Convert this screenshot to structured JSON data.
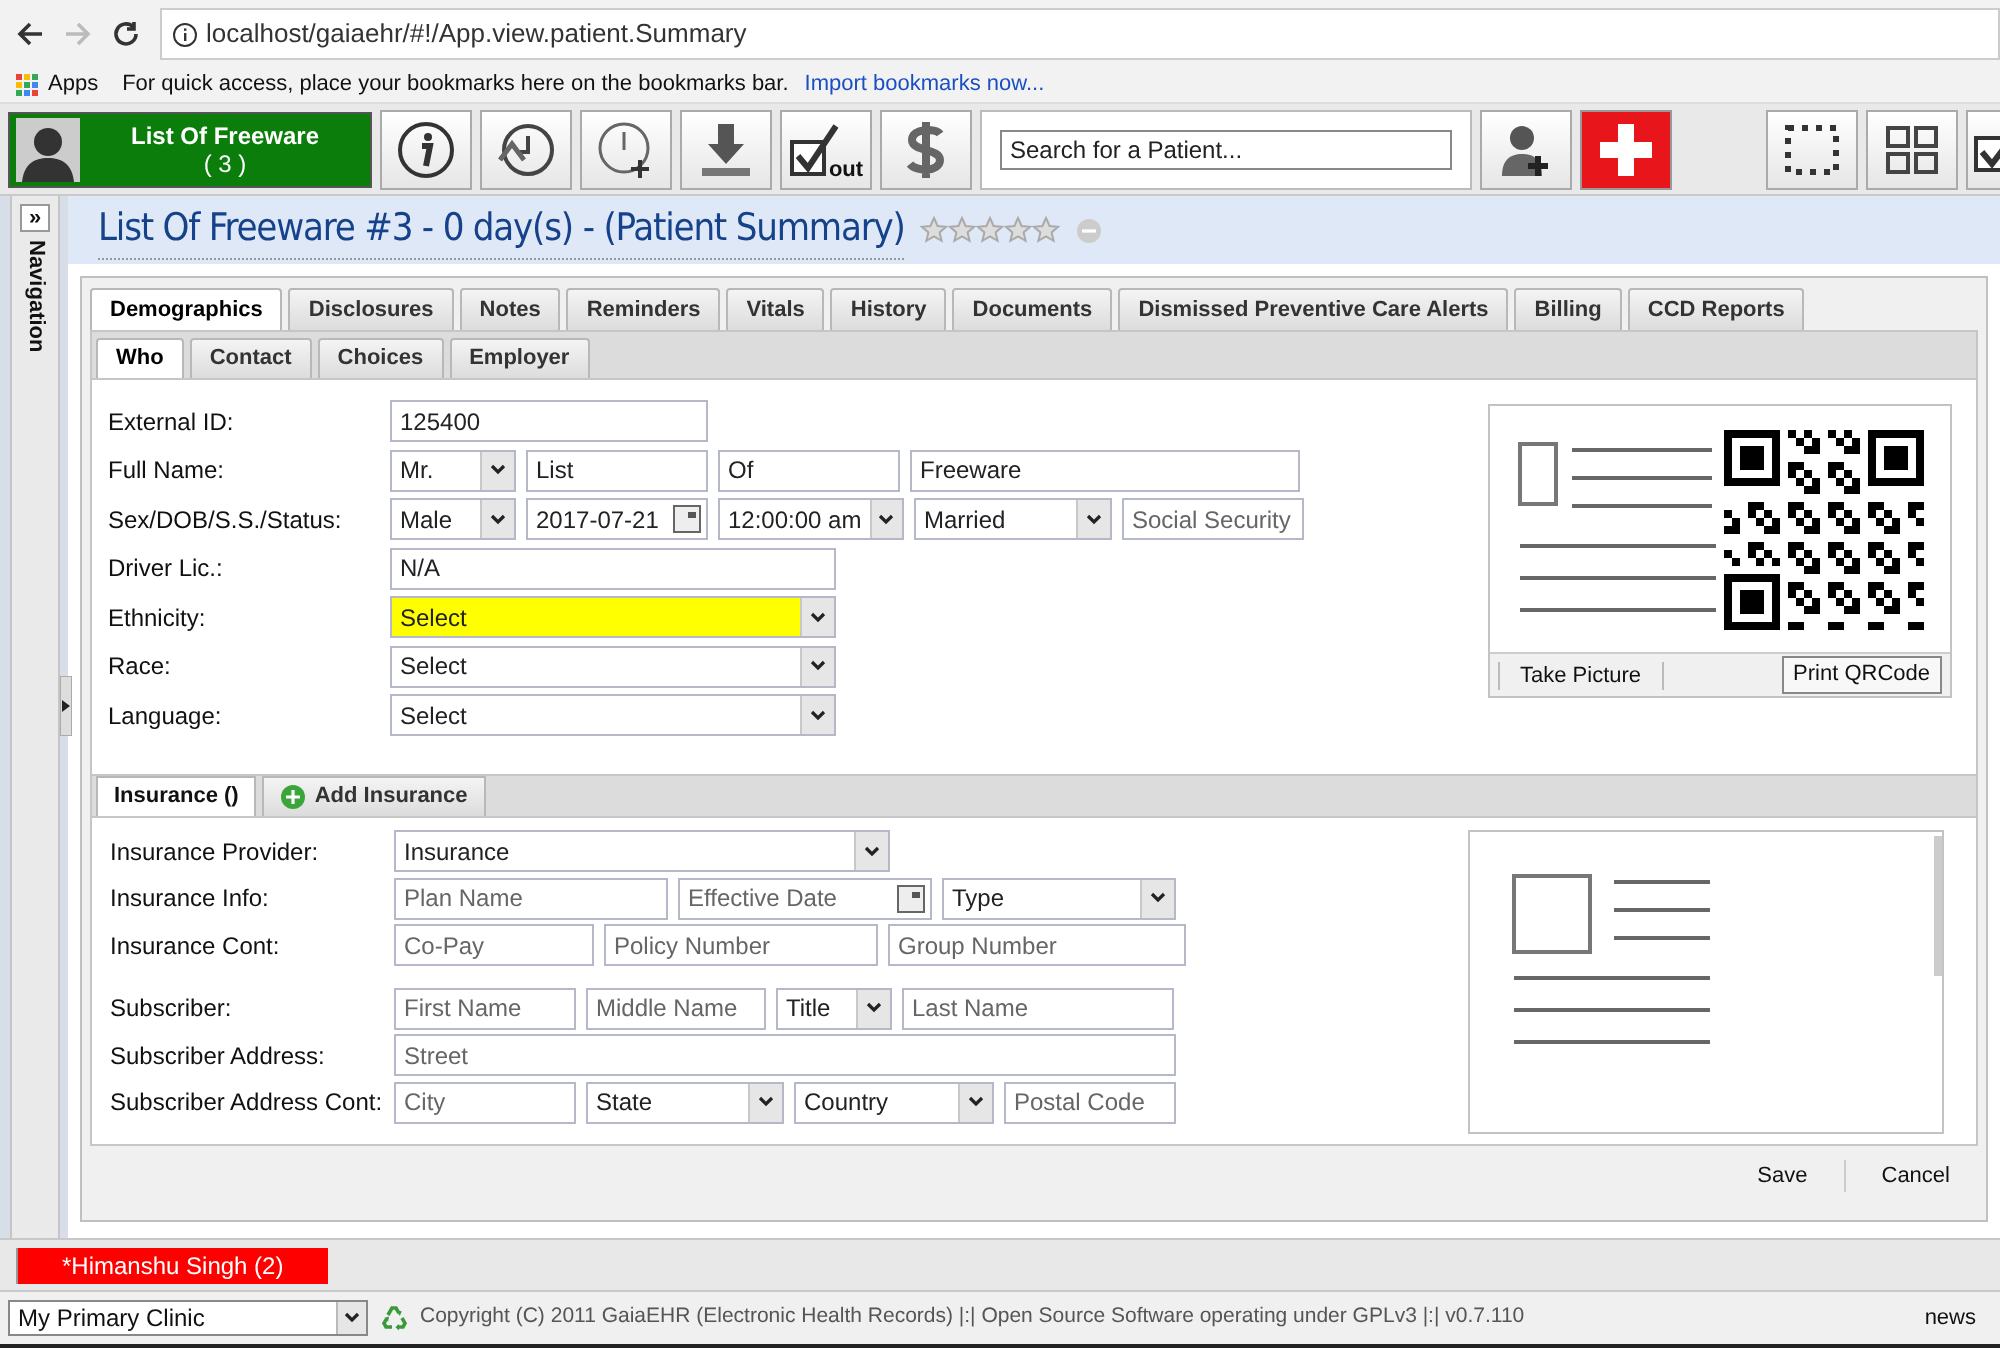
{
  "browser": {
    "url": "localhost/gaiaehr/#!/App.view.patient.Summary",
    "bookmarks": {
      "apps": "Apps",
      "message": "For quick access, place your bookmarks here on the bookmarks bar.",
      "link": "Import bookmarks now..."
    }
  },
  "toolbar": {
    "patient": {
      "name": "List Of Freeware",
      "count": "( 3 )"
    },
    "search": {
      "placeholder": "Search for a Patient..."
    },
    "checkout_label": "out"
  },
  "navigation": {
    "label": "Navigation",
    "toggle": "»"
  },
  "header": {
    "title": "List Of Freeware #3 - 0 day(s) - (Patient Summary)",
    "stars": 0
  },
  "tabs": [
    {
      "label": "Demographics",
      "selected": true
    },
    {
      "label": "Disclosures",
      "selected": false
    },
    {
      "label": "Notes",
      "selected": false
    },
    {
      "label": "Reminders",
      "selected": false
    },
    {
      "label": "Vitals",
      "selected": false
    },
    {
      "label": "History",
      "selected": false
    },
    {
      "label": "Documents",
      "selected": false
    },
    {
      "label": "Dismissed Preventive Care Alerts",
      "selected": false
    },
    {
      "label": "Billing",
      "selected": false
    },
    {
      "label": "CCD Reports",
      "selected": false
    }
  ],
  "subtabs": [
    {
      "label": "Who",
      "selected": true
    },
    {
      "label": "Contact",
      "selected": false
    },
    {
      "label": "Choices",
      "selected": false
    },
    {
      "label": "Employer",
      "selected": false
    }
  ],
  "demographics": [
    {
      "label": "External ID:",
      "highlighted": false,
      "fields": [
        {
          "kind": "text",
          "value": "125400"
        }
      ]
    },
    {
      "label": "Full Name:",
      "highlighted": false,
      "fields": [
        {
          "kind": "select",
          "value": "Mr."
        },
        {
          "kind": "text",
          "value": "List"
        },
        {
          "kind": "text",
          "value": "Of"
        },
        {
          "kind": "text",
          "value": "Freeware"
        }
      ]
    },
    {
      "label": "Sex/DOB/S.S./Status:",
      "highlighted": false,
      "fields": [
        {
          "kind": "select",
          "value": "Male"
        },
        {
          "kind": "date",
          "value": "2017-07-21"
        },
        {
          "kind": "select",
          "value": "12:00:00 am"
        },
        {
          "kind": "select",
          "value": "Married"
        },
        {
          "kind": "text",
          "placeholder": "Social Security"
        }
      ]
    },
    {
      "label": "Driver Lic.:",
      "highlighted": false,
      "fields": [
        {
          "kind": "text",
          "value": "N/A"
        }
      ]
    },
    {
      "label": "Ethnicity:",
      "highlighted": true,
      "fields": [
        {
          "kind": "select",
          "value": "Select"
        }
      ]
    },
    {
      "label": "Race:",
      "highlighted": false,
      "fields": [
        {
          "kind": "select",
          "value": "Select"
        }
      ]
    },
    {
      "label": "Language:",
      "highlighted": false,
      "fields": [
        {
          "kind": "select",
          "value": "Select"
        }
      ]
    }
  ],
  "photo_card": {
    "buttons": [
      "Take Picture",
      "Print QRCode"
    ]
  },
  "insurance_tabs": [
    {
      "label": "Insurance ()",
      "kind": "tab",
      "selected": true
    },
    {
      "label": "Add Insurance",
      "kind": "add",
      "selected": false
    }
  ],
  "insurance": [
    {
      "label": "Insurance Provider:",
      "fields": [
        {
          "kind": "select",
          "value": "Insurance"
        }
      ]
    },
    {
      "label": "Insurance Info:",
      "fields": [
        {
          "kind": "text",
          "placeholder": "Plan Name"
        },
        {
          "kind": "date",
          "placeholder": "Effective Date"
        },
        {
          "kind": "select",
          "value": "Type"
        }
      ]
    },
    {
      "label": "Insurance Cont:",
      "fields": [
        {
          "kind": "text",
          "placeholder": "Co-Pay"
        },
        {
          "kind": "text",
          "placeholder": "Policy Number"
        },
        {
          "kind": "text",
          "placeholder": "Group Number"
        }
      ]
    },
    {
      "label": "Subscriber:",
      "fields": [
        {
          "kind": "text",
          "placeholder": "First Name"
        },
        {
          "kind": "text",
          "placeholder": "Middle Name"
        },
        {
          "kind": "select",
          "value": "Title"
        },
        {
          "kind": "text",
          "placeholder": "Last Name"
        }
      ]
    },
    {
      "label": "Subscriber Address:",
      "fields": [
        {
          "kind": "text",
          "placeholder": "Street"
        }
      ]
    },
    {
      "label": "Subscriber Address Cont:",
      "fields": [
        {
          "kind": "text",
          "placeholder": "City"
        },
        {
          "kind": "select",
          "value": "State"
        },
        {
          "kind": "select",
          "value": "Country"
        },
        {
          "kind": "text",
          "placeholder": "Postal Code"
        }
      ]
    }
  ],
  "actions": [
    "Save",
    "Cancel"
  ],
  "open_patients": [
    {
      "label": "*Himanshu Singh (2)"
    }
  ],
  "status_bar": {
    "clinic": "My Primary Clinic",
    "copyright": "Copyright (C) 2011 GaiaEHR (Electronic Health Records) |:| Open Source Software operating under GPLv3 |:| v0.7.110",
    "news": "news"
  }
}
